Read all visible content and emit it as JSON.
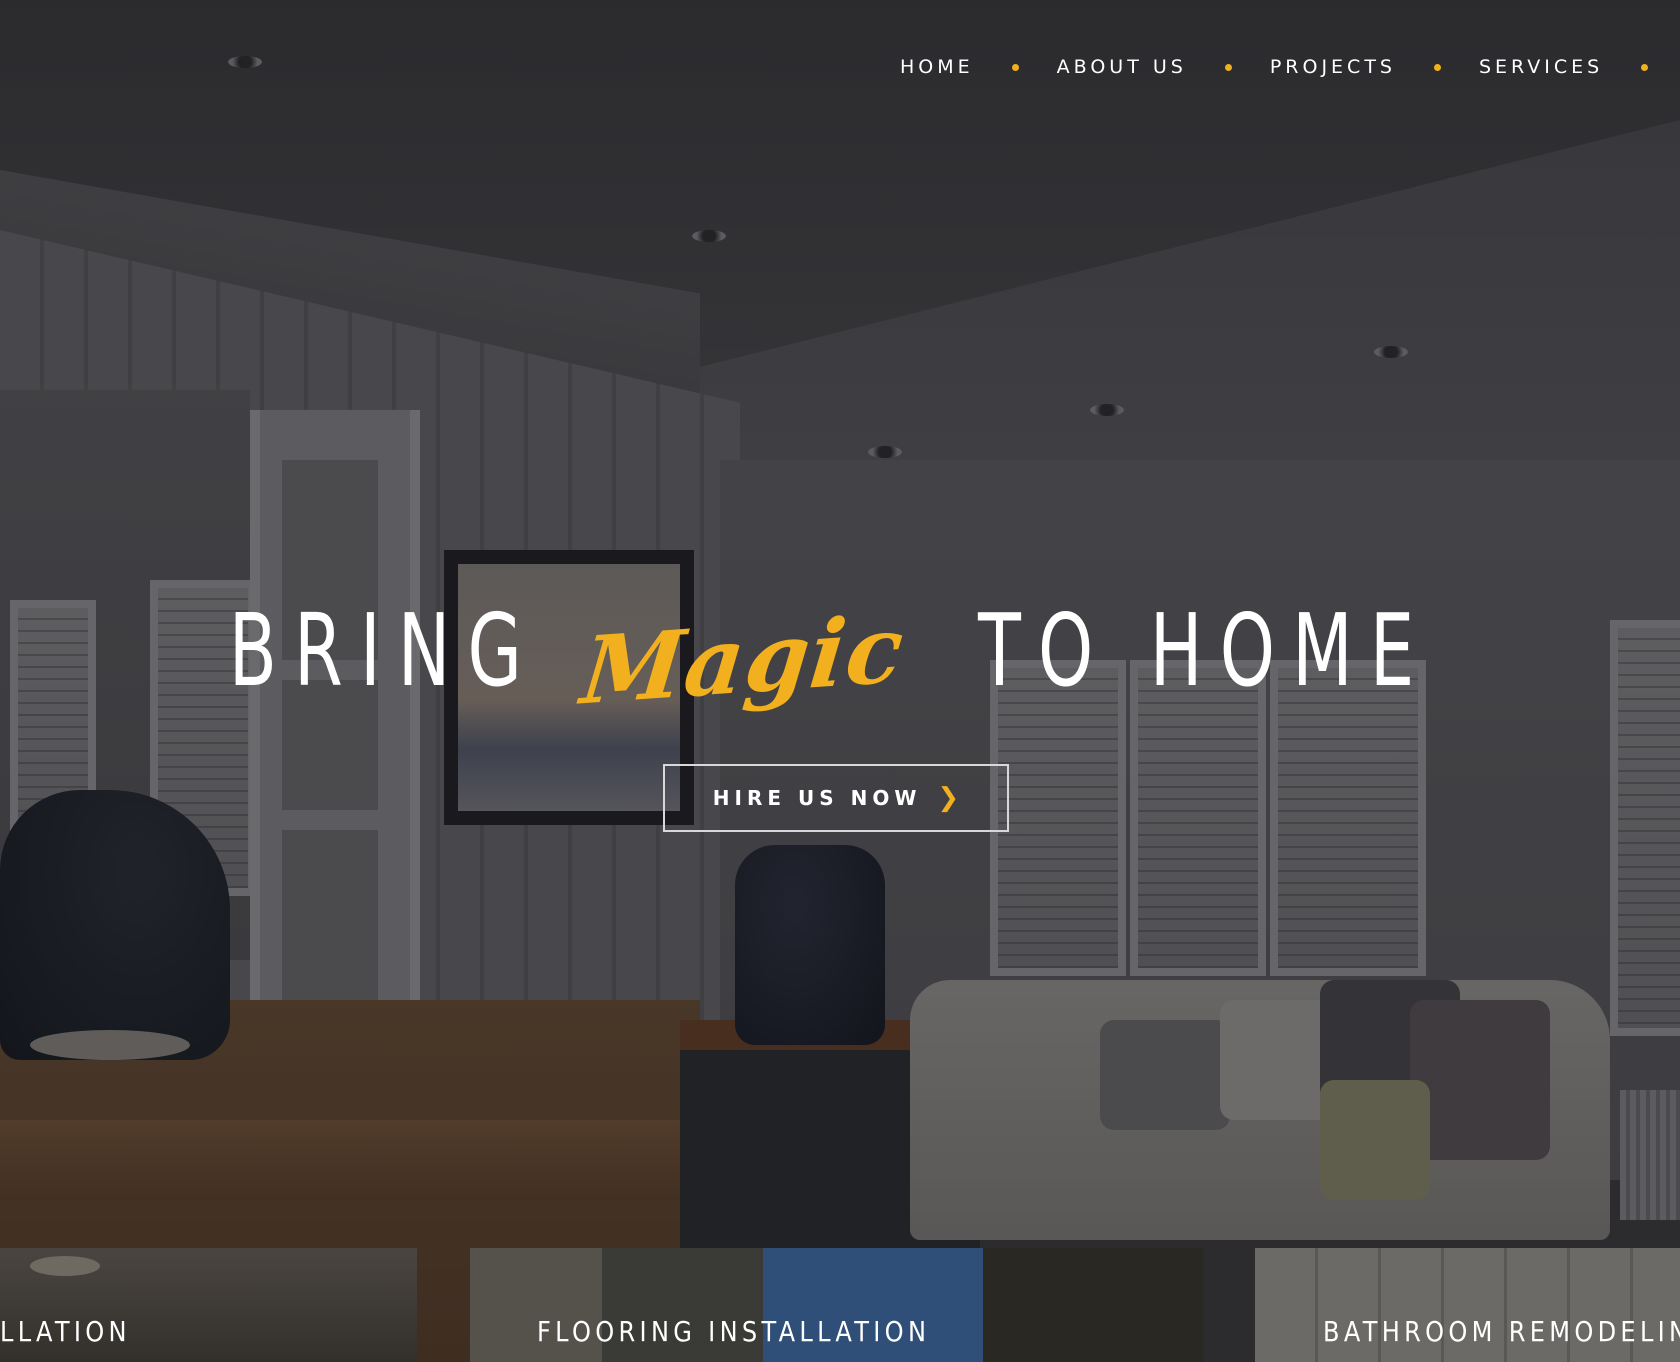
{
  "nav": {
    "items": [
      {
        "label": "HOME"
      },
      {
        "label": "ABOUT US"
      },
      {
        "label": "PROJECTS"
      },
      {
        "label": "SERVICES"
      }
    ]
  },
  "hero": {
    "title_part1": "BRING",
    "title_accent": "Magic",
    "title_part2": "TO HOME",
    "cta_label": "HIRE US NOW",
    "cta_icon": "chevron-right-icon"
  },
  "services": [
    {
      "label": "LLATION"
    },
    {
      "label": "FLOORING INSTALLATION"
    },
    {
      "label": "BATHROOM REMODELIN"
    }
  ],
  "colors": {
    "accent": "#f2b01e",
    "text": "#ffffff"
  }
}
